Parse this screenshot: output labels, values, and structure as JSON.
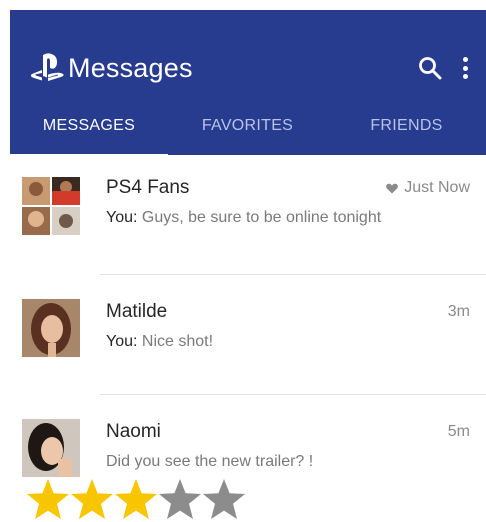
{
  "app": {
    "title": "Messages",
    "brand_color": "#273b8f",
    "icons": [
      "playstation-logo-icon",
      "search-icon",
      "more-vert-icon"
    ]
  },
  "tabs": [
    {
      "label": "MESSAGES",
      "active": true
    },
    {
      "label": "FAVORITES",
      "active": false
    },
    {
      "label": "FRIENDS",
      "active": false
    }
  ],
  "conversations": [
    {
      "name": "PS4 Fans",
      "sender_prefix": "You:",
      "message": "Guys, be sure to be online tonight",
      "time": "Just Now",
      "favorite": true,
      "avatar": "group-avatar"
    },
    {
      "name": "Matilde",
      "sender_prefix": "You:",
      "message": "Nice shot!",
      "time": "3m",
      "favorite": false,
      "avatar": "user-avatar"
    },
    {
      "name": "Naomi",
      "sender_prefix": "",
      "message": "Did you see the new trailer? !",
      "time": "5m",
      "favorite": false,
      "avatar": "user-avatar"
    }
  ],
  "rating": {
    "value": 3,
    "max": 5,
    "filled_color": "#f7c600",
    "empty_color": "#8c8c8c"
  }
}
